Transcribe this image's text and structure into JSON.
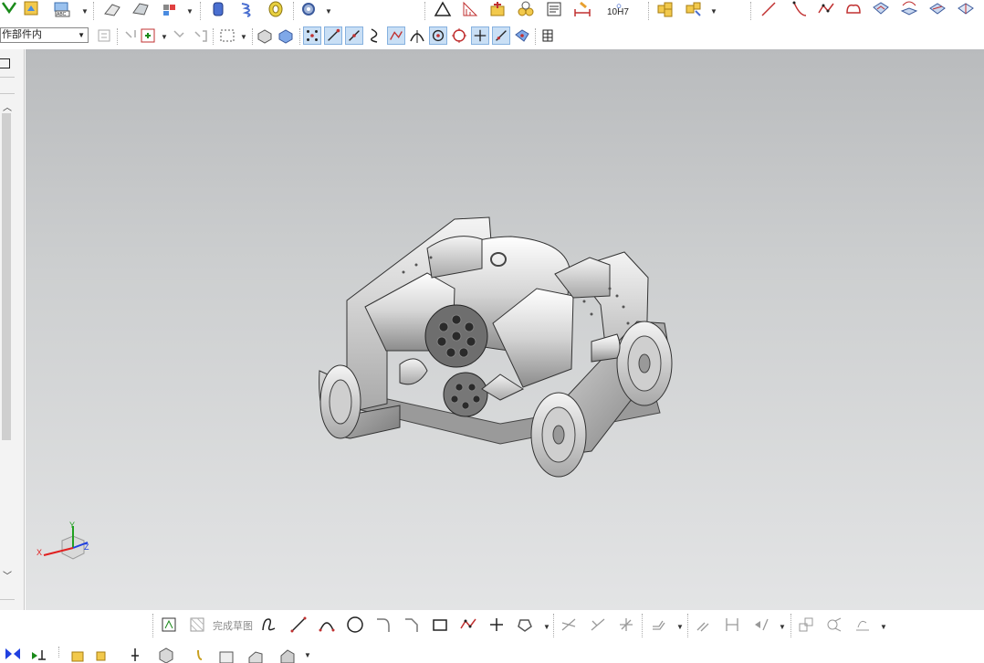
{
  "toolbar": {
    "filter_select_value": "作部件内",
    "tolerance_label": "10H7"
  },
  "sketch_bar": {
    "finish_sketch_label": "完成草图"
  },
  "triad": {
    "x_label": "X",
    "y_label": "Y",
    "z_label": "Z"
  },
  "colors": {
    "viewport_top": "#b9bbbd",
    "viewport_bottom": "#e3e4e5",
    "axis_x": "#e02020",
    "axis_y": "#20a020",
    "axis_z": "#2040e0",
    "selected_tool_bg": "#c9dff5"
  }
}
